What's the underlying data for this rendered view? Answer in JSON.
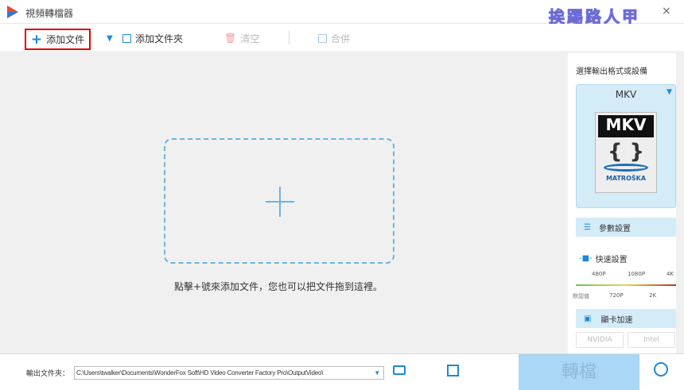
{
  "window": {
    "title": "視頻轉檔器",
    "watermark": "挨踢路人甲"
  },
  "toolbar": {
    "add_file": "添加文件",
    "add_folder": "添加文件夾",
    "clear": "清空",
    "merge": "合併"
  },
  "main": {
    "hint": "點擊+號來添加文件，您也可以把文件拖到這裡。"
  },
  "right_panel": {
    "heading": "選擇輸出格式或設備",
    "format": "MKV",
    "logo_text": {
      "top": "MKV",
      "bottom": "MATROŠKA"
    },
    "params_button": "參數設置",
    "quick_settings": "快速設置",
    "quality_top": [
      "480P",
      "1080P",
      "4K"
    ],
    "quality_bottom": [
      "默認值",
      "720P",
      "2K"
    ],
    "gpu_accel": "顯卡加速",
    "nvidia": "NVIDIA",
    "intel": "Intel"
  },
  "bottom": {
    "output_label": "輸出文件夾：",
    "output_path": "C:\\Users\\twalker\\Documents\\WonderFox Soft\\HD Video Converter Factory Pro\\OutputVideo\\",
    "convert": "轉檔"
  },
  "colors": {
    "accent": "#1e88d6",
    "convert_bg": "#a9d7f5",
    "highlight": "#e00000"
  }
}
